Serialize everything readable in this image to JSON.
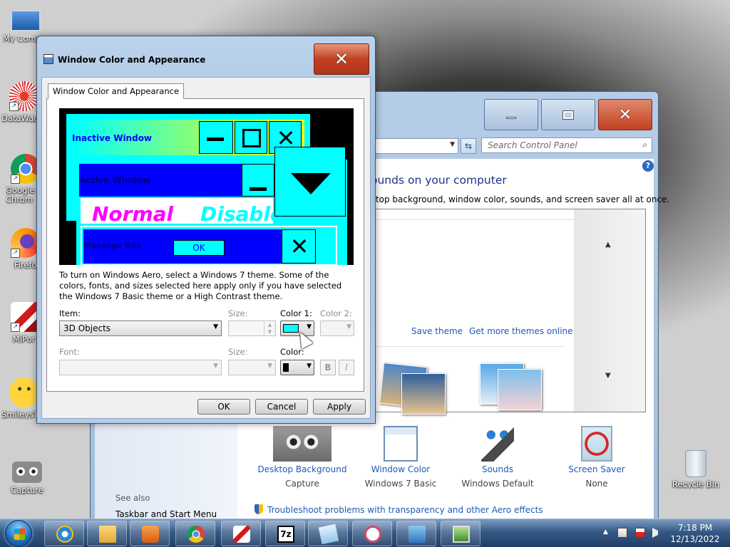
{
  "desktop": {
    "icons": [
      {
        "label": "My Comp",
        "icon": "computer-icon"
      },
      {
        "label": "DataWag",
        "icon": "datawag-icon"
      },
      {
        "label": "Google Chrom",
        "icon": "chrome-icon"
      },
      {
        "label": "Firefo",
        "icon": "firefox-icon"
      },
      {
        "label": "MiPor",
        "icon": "miport-icon"
      },
      {
        "label": "SmileysT",
        "icon": "smiley-icon"
      },
      {
        "label": "Capture",
        "icon": "capture-icon"
      },
      {
        "label": "Recycle Bin",
        "icon": "recycle-bin-icon"
      }
    ]
  },
  "control_panel": {
    "search_placeholder": "Search Control Panel",
    "heading": "ounds on your computer",
    "subtext": "ktop background, window color, sounds, and screen saver all at once.",
    "save_theme": "Save theme",
    "get_more_themes": "Get more themes online",
    "items": [
      {
        "name": "Desktop Background",
        "value": "Capture"
      },
      {
        "name": "Window Color",
        "value": "Windows 7 Basic"
      },
      {
        "name": "Sounds",
        "value": "Windows Default"
      },
      {
        "name": "Screen Saver",
        "value": "None"
      }
    ],
    "see_also": "See also",
    "taskbar_link": "Taskbar and Start Menu",
    "troubleshoot_link": "Troubleshoot problems with transparency and other Aero effects"
  },
  "dialog": {
    "title": "Window Color and Appearance",
    "close_glyph": "✕",
    "tab": "Window Color and Appearance",
    "preview": {
      "inactive_window": "Inactive Window",
      "active_window": "Active Window",
      "normal": "Normal",
      "disabled": "Disable",
      "message_box": "Message Box",
      "ok": "OK"
    },
    "description": "To turn on Windows Aero, select a Windows 7 theme.  Some of the colors, fonts, and sizes selected here apply only if you have selected the Windows 7 Basic theme or a High Contrast theme.",
    "item_label": "Item:",
    "item_value": "3D Objects",
    "size_label": "Size:",
    "color1_label": "Color 1:",
    "color2_label": "Color 2:",
    "font_label": "Font:",
    "font_size_label": "Size:",
    "font_color_label": "Color:",
    "bold_label": "B",
    "italic_label": "I",
    "color1_swatch": "#00ffff",
    "font_color_swatch": "#000000",
    "buttons": {
      "ok": "OK",
      "cancel": "Cancel",
      "apply": "Apply"
    }
  },
  "taskbar": {
    "apps": [
      "internet-explorer-icon",
      "explorer-folder-icon",
      "media-player-icon",
      "chrome-icon",
      "miport-icon",
      "7zip-icon",
      "notes-icon",
      "snipping-tool-icon",
      "control-panel-icon",
      "display-settings-icon"
    ],
    "time": "7:18 PM",
    "date": "12/13/2022"
  },
  "colors": {
    "highcontrast_cyan": "#00ffff",
    "highcontrast_blue": "#0000ff",
    "highcontrast_yellow": "#ffff00",
    "highcontrast_magenta": "#ff00ff",
    "link_blue": "#1e5bb5"
  }
}
